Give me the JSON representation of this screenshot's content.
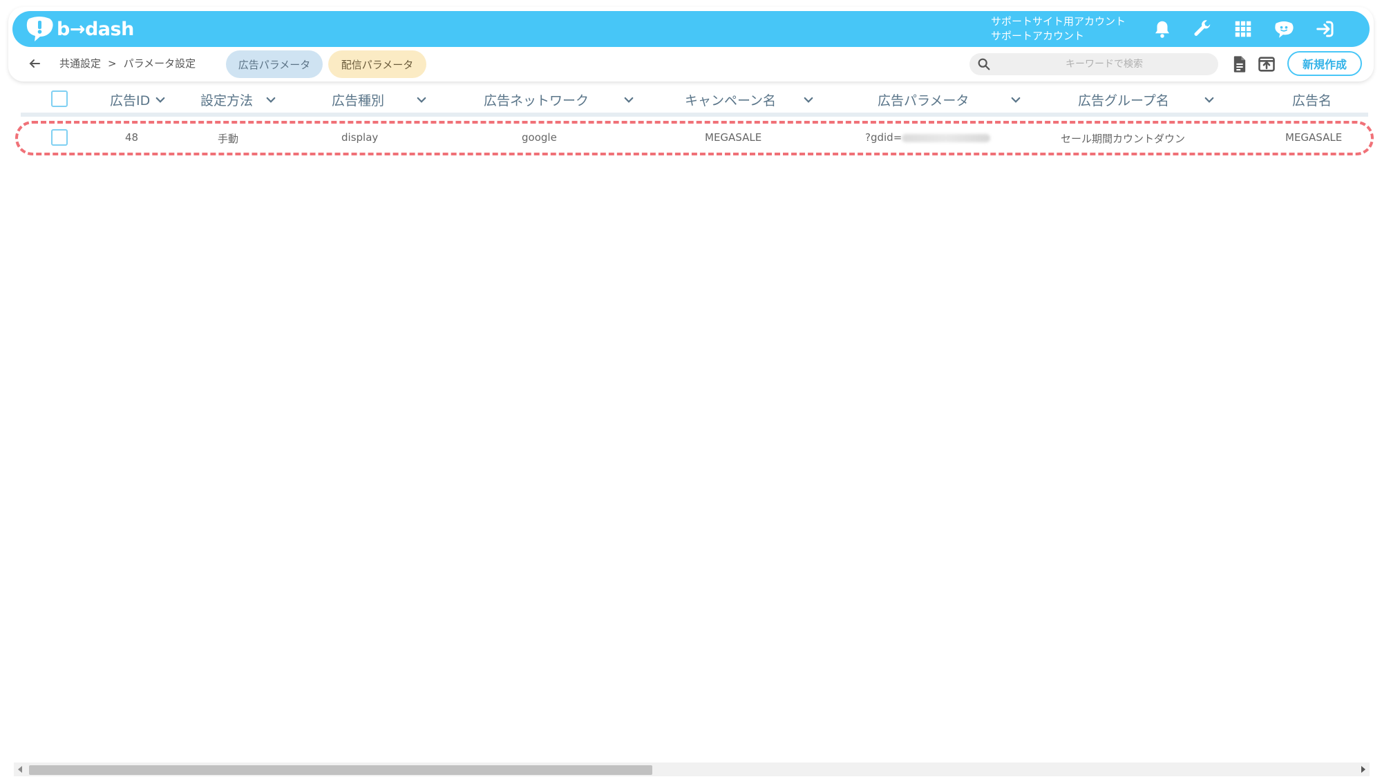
{
  "app": {
    "logo_text": "b→dash"
  },
  "account": {
    "line1": "サポートサイト用アカウント",
    "line2": "サポートアカウント"
  },
  "header_icons": [
    "bell-icon",
    "wrench-icon",
    "grid-icon",
    "chat-bot-icon",
    "login-icon"
  ],
  "breadcrumb": {
    "root": "共通設定",
    "separator": ">",
    "current": "パラメータ設定"
  },
  "tabs": [
    {
      "label": "広告パラメータ"
    },
    {
      "label": "配信パラメータ"
    }
  ],
  "search": {
    "placeholder": "キーワードで検索"
  },
  "toolbar": {
    "new_label": "新規作成"
  },
  "table": {
    "columns": [
      "広告ID",
      "設定方法",
      "広告種別",
      "広告ネットワーク",
      "キャンペーン名",
      "広告パラメータ",
      "広告グループ名",
      "広告名"
    ],
    "rows": [
      {
        "ad_id": "48",
        "method": "手動",
        "ad_type": "display",
        "network": "google",
        "campaign": "MEGASALE",
        "param": "?gdid=",
        "ad_group": "セール期間カウントダウン",
        "ad_name": "MEGASALE"
      }
    ]
  },
  "colors": {
    "accent": "#47c6f7",
    "highlight": "#f07178",
    "tab_ad": "#cfe3f2",
    "tab_delivery": "#fbebc4"
  }
}
